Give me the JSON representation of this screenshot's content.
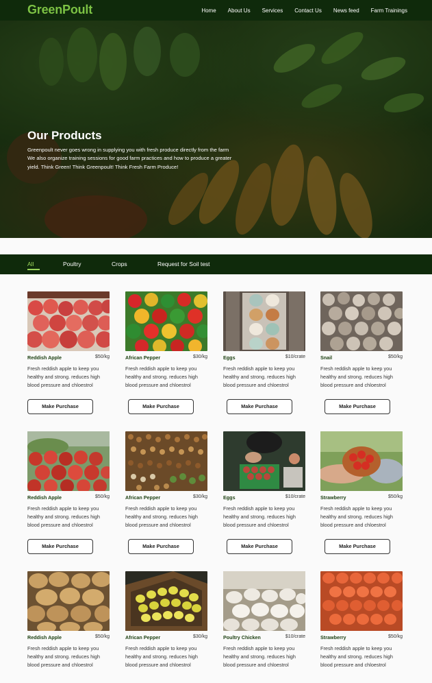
{
  "brand": {
    "name": "GreenPoult",
    "accent": "#7cc244",
    "dark": "#0f2a0b"
  },
  "nav": {
    "items": [
      {
        "label": "Home"
      },
      {
        "label": "About Us"
      },
      {
        "label": "Services"
      },
      {
        "label": "Contact Us"
      },
      {
        "label": "News feed"
      },
      {
        "label": "Farm Trainings"
      }
    ]
  },
  "hero": {
    "title": "Our Products",
    "lines": [
      "Greenpoult never goes wrong in supplying you with fresh produce directly from the farm",
      "We also organize training sessions for good farm practices and how to produce a greater",
      "yield.  Think Green! Think Greenpoult! Think Fresh Farm Produce!"
    ]
  },
  "tabs": [
    {
      "label": "All",
      "active": true
    },
    {
      "label": "Poultry"
    },
    {
      "label": "Crops"
    },
    {
      "label": "Request for Soil test"
    }
  ],
  "products": [
    {
      "name": "Reddish Apple",
      "price": "$50/kg",
      "image": "apples-icon",
      "desc": [
        "Fresh reddish apple to keep you",
        "healthy and strong. reduces high",
        "blood pressure and chloestrol"
      ],
      "button": "Make Purchase"
    },
    {
      "name": "African Pepper",
      "price": "$30/kg",
      "image": "peppers-icon",
      "desc": [
        "Fresh reddish apple to keep you",
        "healthy and strong. reduces high",
        "blood pressure and chloestrol"
      ],
      "button": "Make Purchase"
    },
    {
      "name": "Eggs",
      "price": "$10/crate",
      "image": "eggs-icon",
      "desc": [
        "Fresh reddish apple to keep you",
        "healthy and strong. reduces high",
        "blood pressure and chloestrol"
      ],
      "button": "Make Purchase"
    },
    {
      "name": "Snail",
      "price": "$50/kg",
      "image": "snails-icon",
      "desc": [
        "Fresh reddish apple to keep you",
        "healthy and strong. reduces high",
        "blood pressure and chloestrol"
      ],
      "button": "Make Purchase"
    },
    {
      "name": "Reddish Apple",
      "price": "$50/kg",
      "image": "tomatoes-icon",
      "desc": [
        "Fresh reddish apple to keep you",
        "healthy and strong. reduces high",
        "blood pressure and chloestrol"
      ],
      "button": "Make Purchase"
    },
    {
      "name": "African Pepper",
      "price": "$30/kg",
      "image": "beans-icon",
      "desc": [
        "Fresh reddish apple to keep you",
        "healthy and strong. reduces high",
        "blood pressure and chloestrol"
      ],
      "button": "Make Purchase"
    },
    {
      "name": "Eggs",
      "price": "$10/crate",
      "image": "harvest-crate-icon",
      "desc": [
        "Fresh reddish apple to keep you",
        "healthy and strong. reduces high",
        "blood pressure and chloestrol"
      ],
      "button": "Make Purchase"
    },
    {
      "name": "Strawberry",
      "price": "$50/kg",
      "image": "tomato-bowl-icon",
      "desc": [
        "Fresh reddish apple to keep you",
        "healthy and strong. reduces high",
        "blood pressure and chloestrol"
      ],
      "button": "Make Purchase"
    },
    {
      "name": "Reddish Apple",
      "price": "$50/kg",
      "image": "potatoes-icon",
      "desc": [
        "Fresh reddish apple to keep you",
        "healthy and strong. reduces high",
        "blood pressure and chloestrol"
      ],
      "button": ""
    },
    {
      "name": "African Pepper",
      "price": "$30/kg",
      "image": "lemons-icon",
      "desc": [
        "Fresh reddish apple to keep you",
        "healthy and strong. reduces high",
        "blood pressure and chloestrol"
      ],
      "button": ""
    },
    {
      "name": "Poultry Chicken",
      "price": "$10/crate",
      "image": "chickens-icon",
      "desc": [
        "Fresh reddish apple to keep you",
        "healthy and strong. reduces high",
        "blood pressure and chloestrol"
      ],
      "button": ""
    },
    {
      "name": "Strawberry",
      "price": "$50/kg",
      "image": "carrots-icon",
      "desc": [
        "Fresh reddish apple to keep you",
        "healthy and strong. reduces high",
        "blood pressure and chloestrol"
      ],
      "button": ""
    }
  ]
}
